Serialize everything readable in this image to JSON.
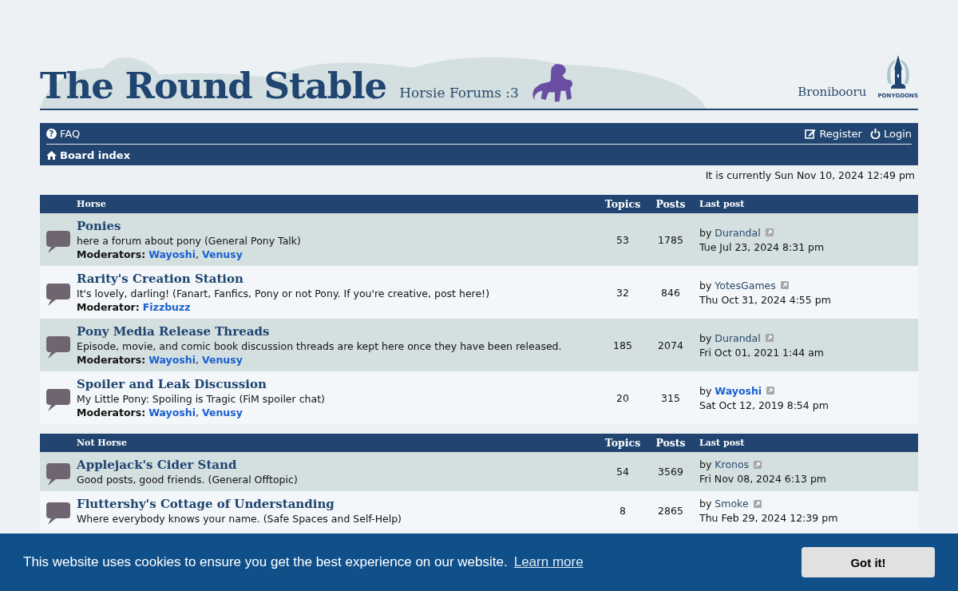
{
  "header": {
    "site_title": "The Round Stable",
    "tagline": "Horsie Forums :3",
    "link": "Bronibooru",
    "logo_text": "PONYGOONS"
  },
  "navbar": {
    "left": [
      {
        "label": "FAQ",
        "icon_glyph": "?"
      }
    ],
    "right": [
      {
        "label": "Register"
      },
      {
        "label": "Login"
      }
    ],
    "breadcrumb": {
      "label": "Board index"
    }
  },
  "moderator_separator": ",",
  "current_time": "It is currently Sun Nov 10, 2024 12:49 pm",
  "categories": [
    {
      "name": "Horse",
      "columns": [
        "Topics",
        "Posts",
        "Last post"
      ],
      "forums": [
        {
          "title": "Ponies",
          "description": "here a forum about pony (General Pony Talk)",
          "moderator_label": "Moderators:",
          "moderators": [
            "Wayoshi",
            "Venusy"
          ],
          "topics": "53",
          "posts": "1785",
          "last_by": "by",
          "last_author": "Durandal",
          "author_highlighted": false,
          "last_date": "Tue Jul 23, 2024 8:31 pm"
        },
        {
          "title": "Rarity's Creation Station",
          "description": "It's lovely, darling! (Fanart, Fanfics, Pony or not Pony. If you're creative, post here!)",
          "moderator_label": "Moderator:",
          "moderators": [
            "Fizzbuzz"
          ],
          "topics": "32",
          "posts": "846",
          "last_by": "by",
          "last_author": "YotesGames",
          "author_highlighted": false,
          "last_date": "Thu Oct 31, 2024 4:55 pm"
        },
        {
          "title": "Pony Media Release Threads",
          "description": "Episode, movie, and comic book discussion threads are kept here once they have been released.",
          "moderator_label": "Moderators:",
          "moderators": [
            "Wayoshi",
            "Venusy"
          ],
          "topics": "185",
          "posts": "2074",
          "last_by": "by",
          "last_author": "Durandal",
          "author_highlighted": false,
          "last_date": "Fri Oct 01, 2021 1:44 am"
        },
        {
          "title": "Spoiler and Leak Discussion",
          "description": "My Little Pony: Spoiling is Tragic (FiM spoiler chat)",
          "moderator_label": "Moderators:",
          "moderators": [
            "Wayoshi",
            "Venusy"
          ],
          "topics": "20",
          "posts": "315",
          "last_by": "by",
          "last_author": "Wayoshi",
          "author_highlighted": true,
          "last_date": "Sat Oct 12, 2019 8:54 pm"
        }
      ]
    },
    {
      "name": "Not Horse",
      "columns": [
        "Topics",
        "Posts",
        "Last post"
      ],
      "forums": [
        {
          "title": "Applejack's Cider Stand",
          "description": "Good posts, good friends. (General Offtopic)",
          "topics": "54",
          "posts": "3569",
          "last_by": "by",
          "last_author": "Kronos",
          "author_highlighted": false,
          "last_date": "Fri Nov 08, 2024 6:13 pm"
        },
        {
          "title": "Fluttershy's Cottage of Understanding",
          "description": "Where everybody knows your name. (Safe Spaces and Self-Help)",
          "topics": "8",
          "posts": "2865",
          "last_by": "by",
          "last_author": "Smoke",
          "author_highlighted": false,
          "last_date": "Thu Feb 29, 2024 12:39 pm"
        }
      ]
    }
  ],
  "cookie_banner": {
    "message": "This website uses cookies to ensure you get the best experience on our website.",
    "link": "Learn more",
    "button": "Got it!"
  }
}
